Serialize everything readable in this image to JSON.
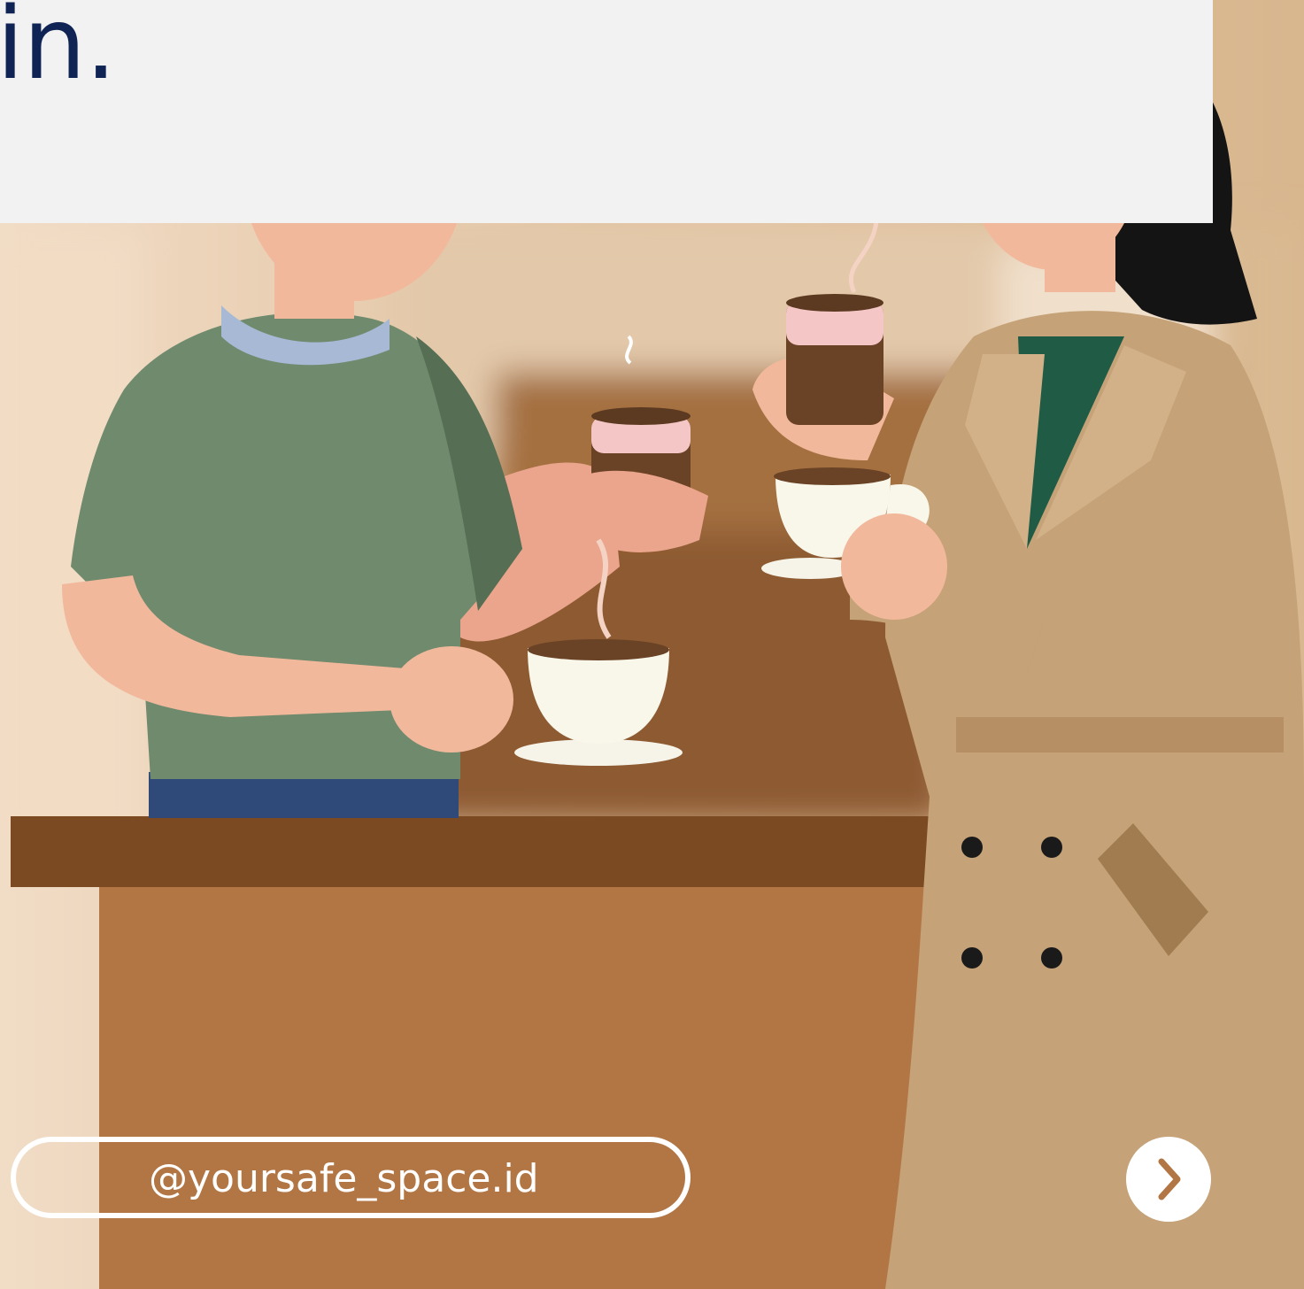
{
  "banner": {
    "text": "in."
  },
  "footer": {
    "handle": "@yoursafe_space.id",
    "next_icon": "chevron-right-icon"
  },
  "colors": {
    "banner_text": "#0f2454",
    "banner_bg": "#f2f2f2",
    "counter_top": "#7b4a22",
    "counter_front": "#b27645",
    "coat": "#c5a277",
    "sweater": "#6f8a6d"
  }
}
